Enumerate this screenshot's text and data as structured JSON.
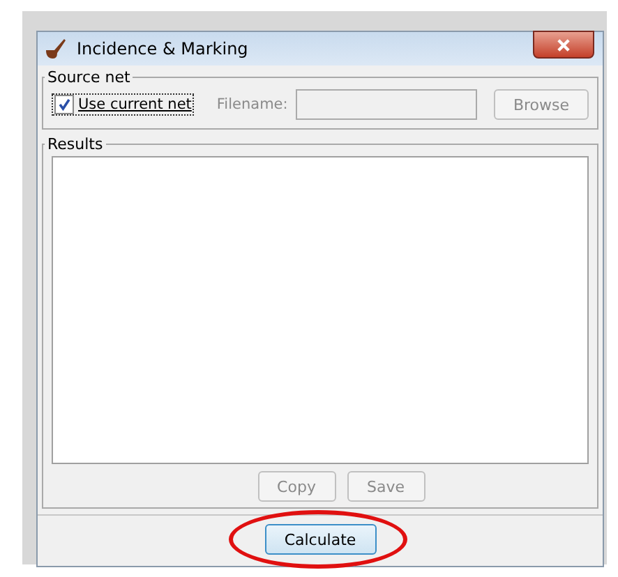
{
  "window": {
    "title": "Incidence & Marking"
  },
  "source_net": {
    "title": "Source net",
    "use_current": {
      "label": "Use current net",
      "checked": true
    },
    "filename": {
      "label": "Filename:",
      "disabled": true
    },
    "browse": {
      "label": "Browse",
      "disabled": true
    }
  },
  "results": {
    "title": "Results",
    "buttons": [
      {
        "label": "Copy",
        "disabled": true
      },
      {
        "label": "Save",
        "disabled": true
      }
    ]
  },
  "calculate": {
    "label": "Calculate",
    "highlighted": true
  }
}
